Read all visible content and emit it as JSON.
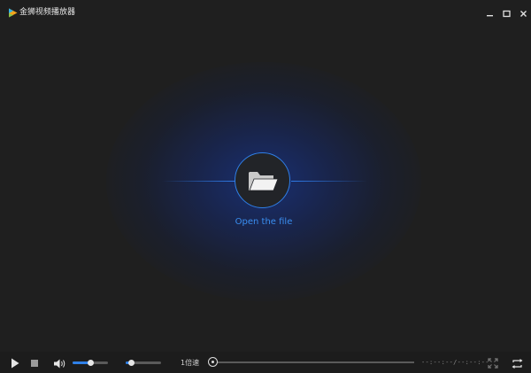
{
  "window": {
    "title": "金狮视频播放器"
  },
  "titlebar": {
    "icons": [
      "app-logo-icon",
      "minimize-icon",
      "maximize-icon",
      "close-icon"
    ]
  },
  "center": {
    "open_label": "Open the file",
    "icon": "folder-open-icon"
  },
  "controls": {
    "play_icon": "play-icon",
    "stop_icon": "stop-icon",
    "volume_icon": "volume-icon",
    "volume_level": 0.5,
    "second_slider_level": 0.15,
    "speed_label": "1倍速",
    "progress": 0.0,
    "time_display": "--:--:--/--:--:--",
    "fullscreen_icon": "fullscreen-icon",
    "loop_icon": "loop-icon"
  },
  "colors": {
    "background": "#1f1f1f",
    "accent": "#2f80e8",
    "open_label": "#3a8ef0"
  }
}
